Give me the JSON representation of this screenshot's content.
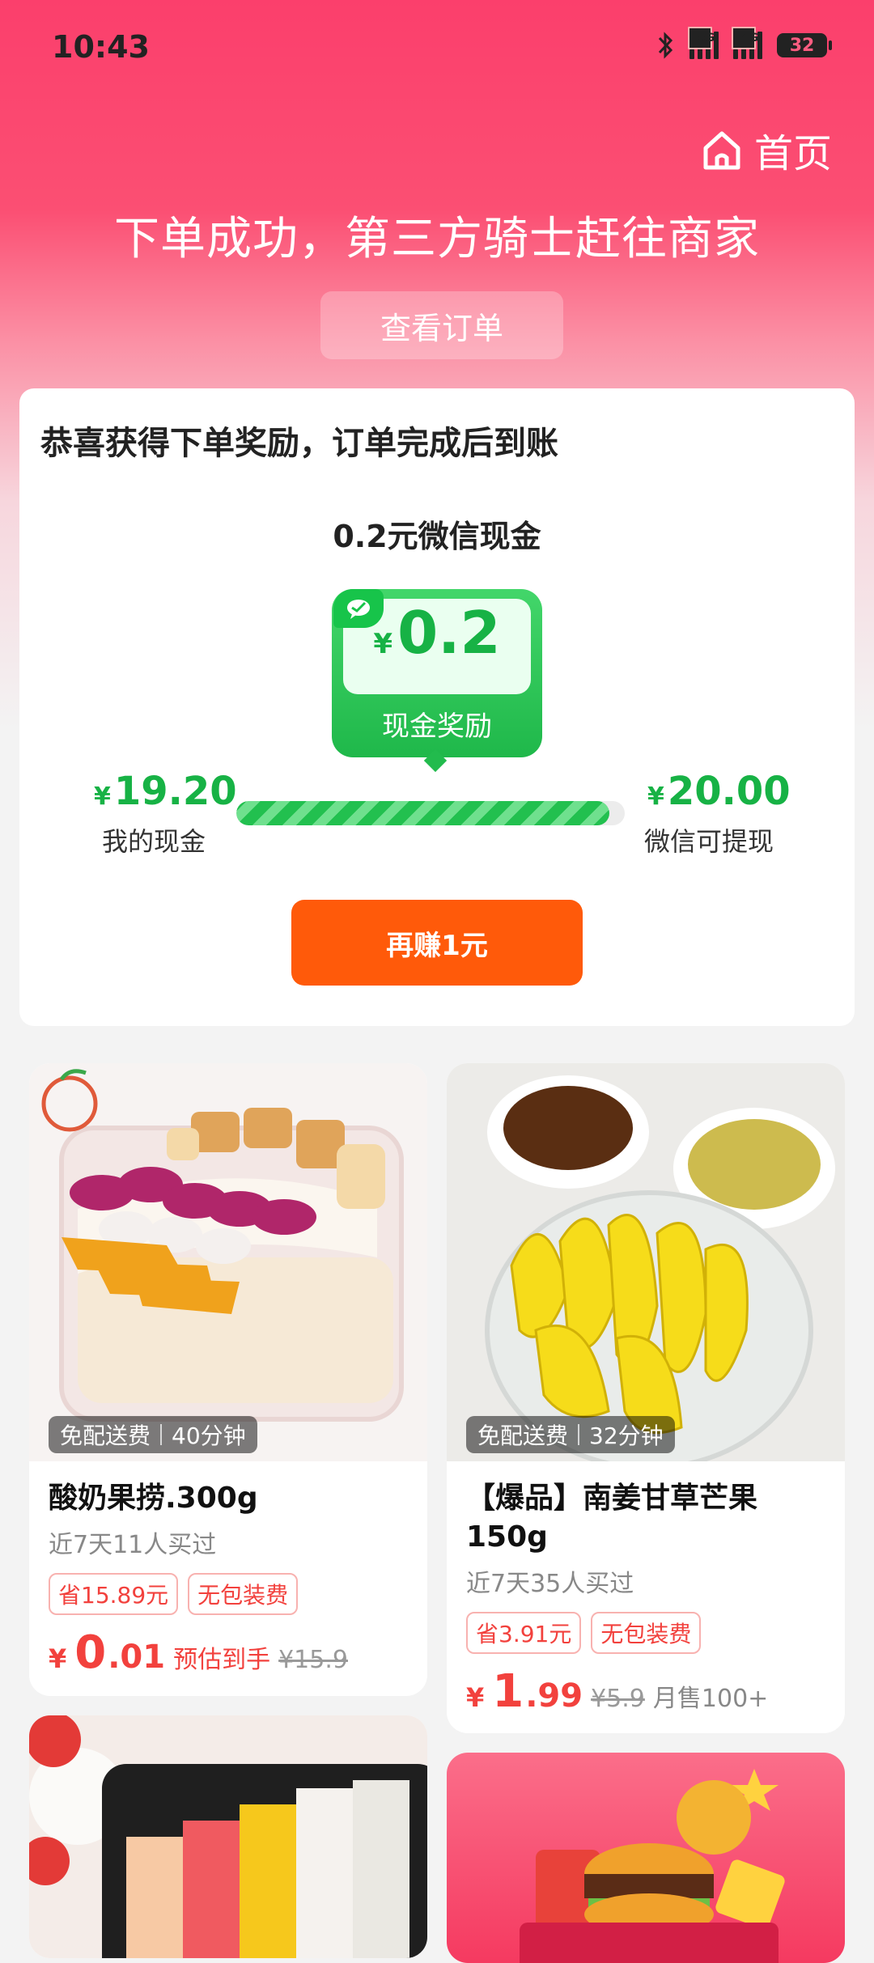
{
  "status_bar": {
    "time": "10:43",
    "net1": "5G",
    "net2": "4G",
    "battery": "32"
  },
  "header": {
    "home_label": "首页",
    "title": "下单成功，第三方骑士赶往商家",
    "view_order": "查看订单"
  },
  "reward": {
    "heading": "恭喜获得下单奖励，订单完成后到账",
    "cash_title": "0.2元微信现金",
    "currency": "¥",
    "cash_amount": "0.2",
    "cash_label": "现金奖励",
    "my_cash": "19.20",
    "my_cash_label": "我的现金",
    "withdraw": "20.00",
    "withdraw_label": "微信可提现",
    "progress_fraction": 0.96,
    "button": "再赚1元",
    "accent_color": "#17b245",
    "button_color": "#ff5a0a"
  },
  "products": [
    {
      "delivery": "免配送费",
      "eta": "40分钟",
      "name": "酸奶果捞.300g",
      "sold": "近7天11人买过",
      "tag1": "省15.89元",
      "tag2": "无包装费",
      "currency": "¥",
      "price_int": "0",
      "price_dec": ".01",
      "note": "预估到手",
      "original": "¥15.9"
    },
    {
      "delivery": "免配送费",
      "eta": "32分钟",
      "name": "【爆品】南姜甘草芒果150g",
      "sold": "近7天35人买过",
      "tag1": "省3.91元",
      "tag2": "无包装费",
      "currency": "¥",
      "price_int": "1",
      "price_dec": ".99",
      "original": "¥5.9",
      "monthly": "月售100+"
    }
  ]
}
